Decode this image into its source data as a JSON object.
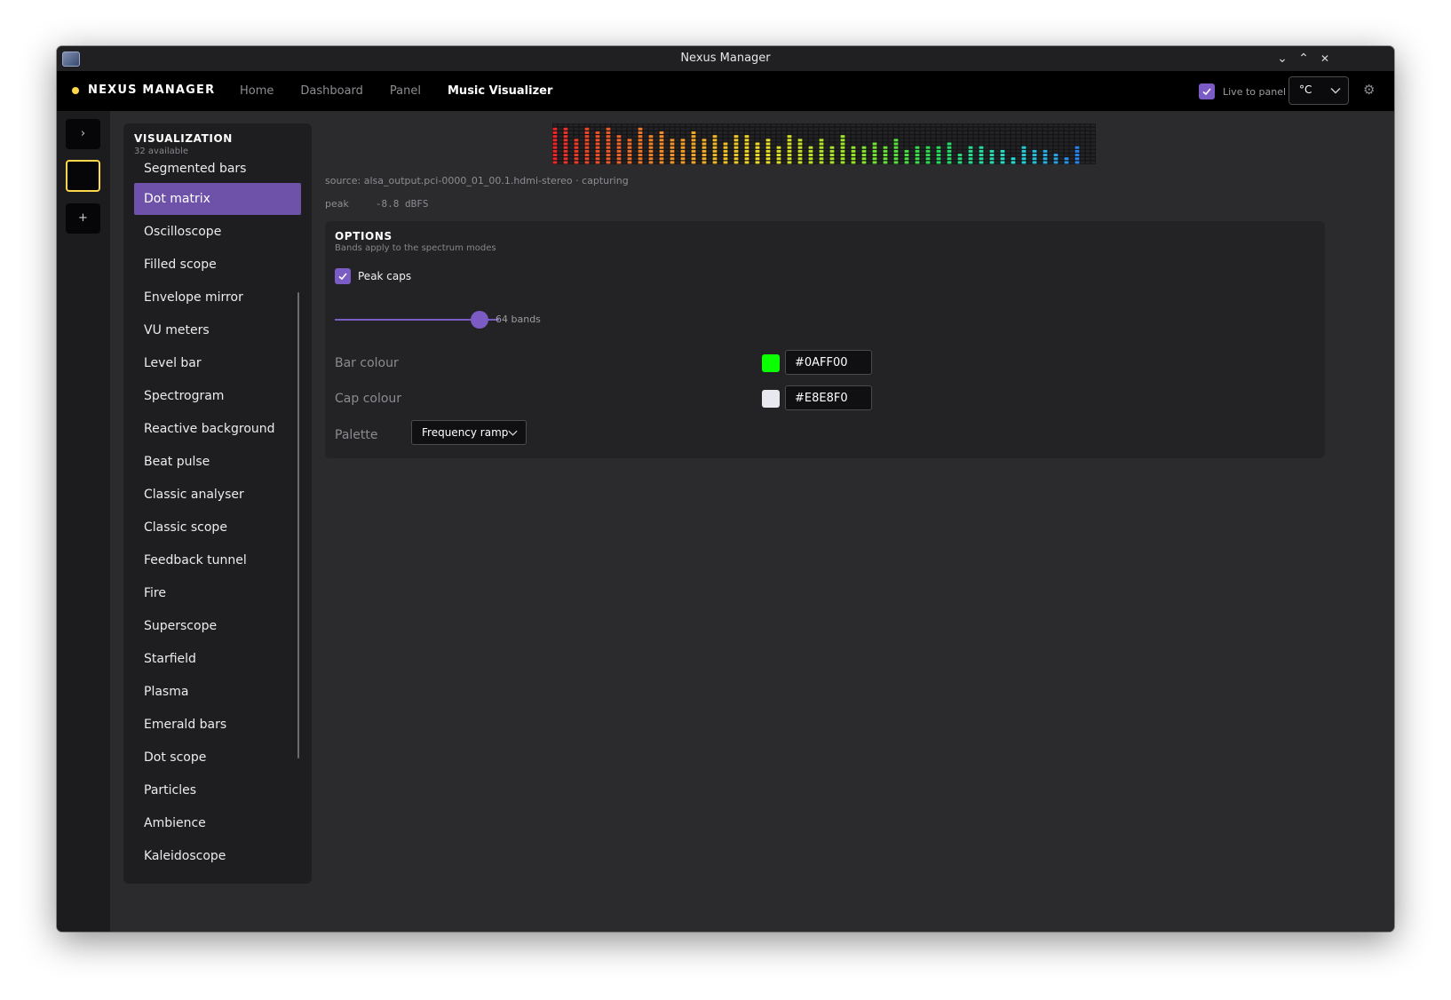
{
  "window": {
    "title": "Nexus Manager",
    "controls": {
      "minimize": "⌄",
      "maximize": "⌃",
      "close": "✕"
    }
  },
  "header": {
    "brand": "NEXUS MANAGER",
    "brand_color": "#ffd84a",
    "tabs": [
      {
        "label": "Home",
        "active": false
      },
      {
        "label": "Dashboard",
        "active": false
      },
      {
        "label": "Panel",
        "active": false
      },
      {
        "label": "Music Visualizer",
        "active": true
      }
    ],
    "live_to_panel": {
      "label": "Live to panel",
      "checked": true
    },
    "unit": {
      "value": "°C"
    },
    "settings_icon": "gear-icon"
  },
  "rail": {
    "expand": "›",
    "add": "+"
  },
  "visualization": {
    "title": "VISUALIZATION",
    "subtitle": "32 available",
    "items": [
      "Segmented bars",
      "Dot matrix",
      "Oscilloscope",
      "Filled scope",
      "Envelope mirror",
      "VU meters",
      "Level bar",
      "Spectrogram",
      "Reactive background",
      "Beat pulse",
      "Classic analyser",
      "Classic scope",
      "Feedback tunnel",
      "Fire",
      "Superscope",
      "Starfield",
      "Plasma",
      "Emerald bars",
      "Dot scope",
      "Particles",
      "Ambience",
      "Kaleidoscope"
    ],
    "selected": "Dot matrix"
  },
  "status": {
    "source": "source: alsa_output.pci-0000_01_00.1.hdmi-stereo · capturing",
    "peak_label": "peak",
    "peak_value": "-8.8 dBFS"
  },
  "options": {
    "title": "OPTIONS",
    "subtitle": "Bands apply to the spectrum modes",
    "peak_caps": {
      "label": "Peak caps",
      "checked": true
    },
    "bands": {
      "label": "64 bands",
      "value": 64,
      "fraction": 0.88
    },
    "bar_colour": {
      "label": "Bar colour",
      "value": "#0AFF00"
    },
    "cap_colour": {
      "label": "Cap colour",
      "value": "#E8E8F0"
    },
    "palette": {
      "label": "Palette",
      "value": "Frequency ramp"
    }
  },
  "accent_color": "#7b5cc4"
}
